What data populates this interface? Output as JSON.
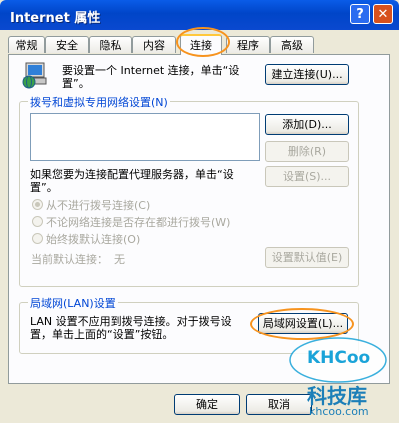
{
  "window": {
    "title": "Internet 属性",
    "help": "?",
    "close": "✕"
  },
  "tabs": [
    "常规",
    "安全",
    "隐私",
    "内容",
    "连接",
    "程序",
    "高级"
  ],
  "active_tab": "连接",
  "setup": {
    "text_line1": "要设置一个 Internet 连接，单击“设",
    "text_line2": "置”。",
    "button": "建立连接(U)..."
  },
  "dialup": {
    "group_title": "拨号和虚拟专用网络设置(N)",
    "add_button": "添加(D)...",
    "delete_button": "删除(R)",
    "settings_button": "设置(S)...",
    "proxy_line1": "如果您要为连接配置代理服务器，单击“设",
    "proxy_line2": "置”。",
    "options": [
      {
        "label": "从不进行拨号连接(C)",
        "selected": true
      },
      {
        "label": "不论网络连接是否存在都进行拨号(W)",
        "selected": false
      },
      {
        "label": "始终拨默认连接(O)",
        "selected": false
      }
    ],
    "current_default_label": "当前默认连接：",
    "current_default_value": "无",
    "set_default_button": "设置默认值(E)"
  },
  "lan": {
    "group_title": "局域网(LAN)设置",
    "text_line1": "LAN 设置不应用到拨号连接。对于拨号设",
    "text_line2": "置，单击上面的“设置”按钮。",
    "button": "局域网设置(L)..."
  },
  "footer": {
    "ok": "确定",
    "cancel": "取消"
  },
  "watermark": {
    "logo": "KHCoo",
    "site_cn": "科技库",
    "site_url": "khcoo.com"
  },
  "colors": {
    "title_bar": "#0a5ce8",
    "group_title": "#0046d5",
    "highlight": "#f7931e"
  }
}
